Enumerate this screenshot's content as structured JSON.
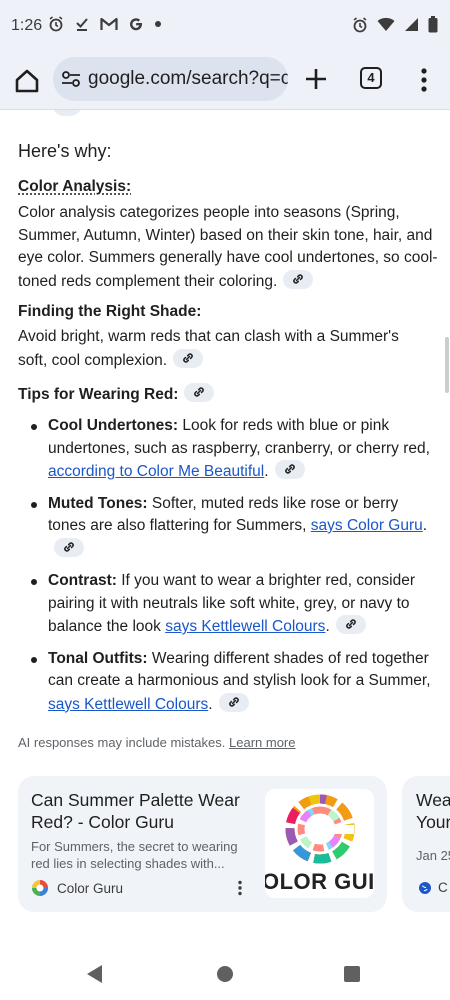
{
  "status_bar": {
    "time": "1:26",
    "left_icons": [
      "alarm-icon",
      "download-done-icon",
      "gmail-icon",
      "google-icon",
      "dot-icon"
    ],
    "right_icons": [
      "alarm-icon",
      "wifi-icon",
      "signal-icon",
      "battery-icon"
    ]
  },
  "toolbar": {
    "url": "google.com/search?q=c",
    "tab_count": "4"
  },
  "content": {
    "heading": "Here's why:",
    "color_analysis": {
      "title": "Color Analysis:",
      "text": "Color analysis categorizes people into seasons (Spring, Summer, Autumn, Winter) based on their skin tone, hair, and eye color. Summers generally have cool undertones, so cool-toned reds complement their coloring."
    },
    "finding_shade": {
      "title": "Finding the Right Shade:",
      "text": "Avoid bright, warm reds that can clash with a Summer's soft, cool complexion."
    },
    "tips": {
      "title": "Tips for Wearing Red:",
      "items": [
        {
          "label": "Cool Undertones:",
          "text": " Look for reds with blue or pink undertones, such as raspberry, cranberry, or cherry red, ",
          "link": "according to Color Me Beautiful",
          "end": "."
        },
        {
          "label": "Muted Tones:",
          "text": " Softer, muted reds like rose or berry tones are also flattering for Summers, ",
          "link": "says Color Guru",
          "end": "."
        },
        {
          "label": "Contrast:",
          "text": " If you want to wear a brighter red, consider pairing it with neutrals like soft white, grey, or navy to balance the look ",
          "link": "says Kettlewell Colours",
          "end": "."
        },
        {
          "label": "Tonal Outfits:",
          "text": " Wearing different shades of red together can create a harmonious and stylish look for a Summer, ",
          "link": "says Kettlewell Colours",
          "end": "."
        }
      ]
    },
    "disclaimer": "AI responses may include mistakes.",
    "learn_more": "Learn more"
  },
  "cards": [
    {
      "title": "Can Summer Palette Wear Red? - Color Guru",
      "snippet": "For Summers, the secret to wearing red lies in selecting shades with...",
      "source": "Color Guru",
      "thumb_text": "OLOR GUI"
    },
    {
      "title_line1": "Wea",
      "title_line2": "Your",
      "date": "Jan 25",
      "source": "C"
    }
  ],
  "colors": {
    "link": "#1a57c8",
    "toolbar_bg": "#eef1f8",
    "chip_bg": "#e8ecf3"
  }
}
